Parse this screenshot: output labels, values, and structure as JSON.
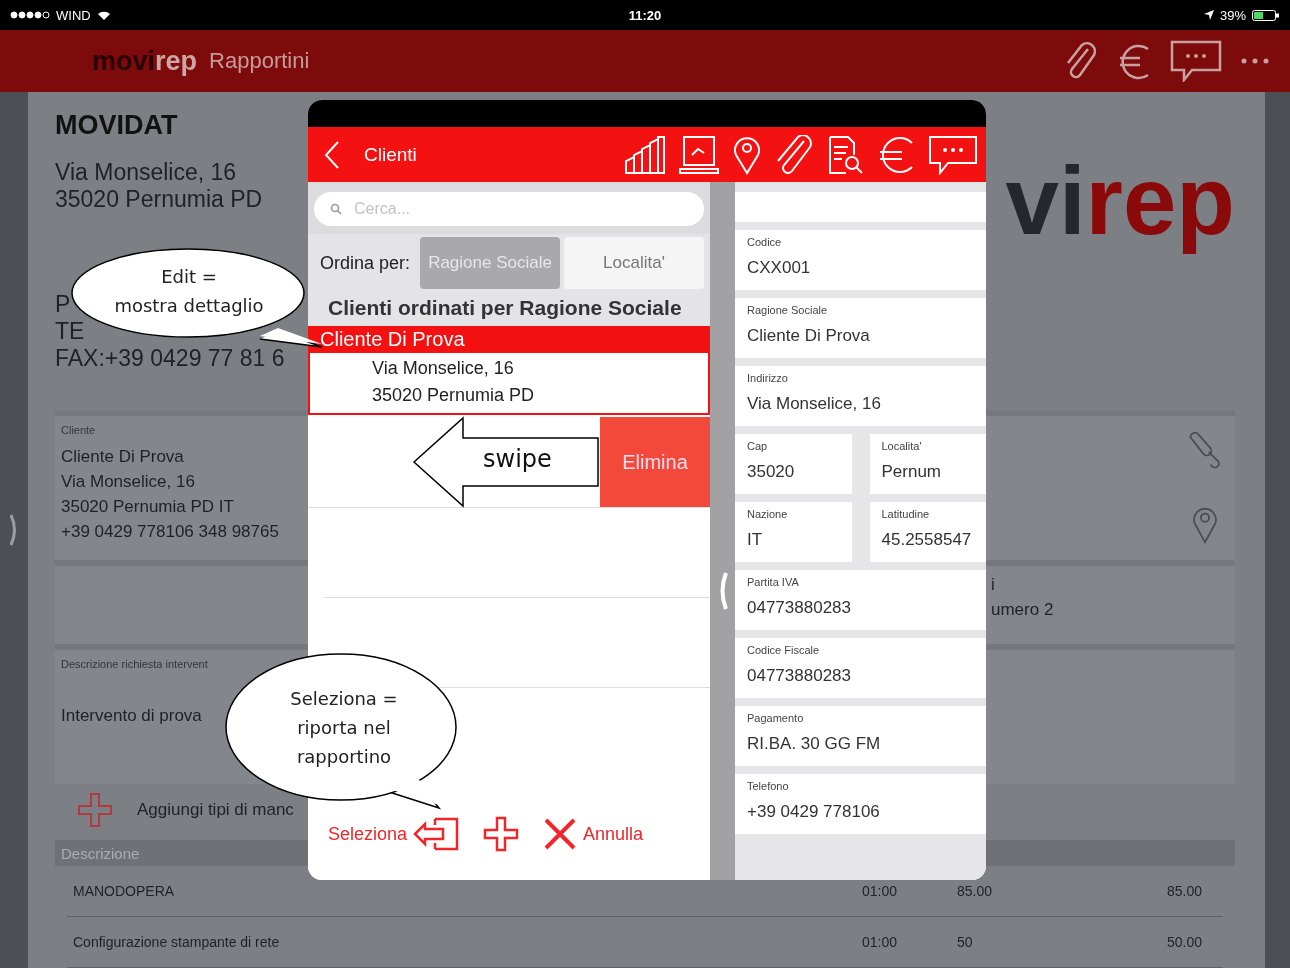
{
  "status_bar": {
    "carrier": "WIND",
    "time": "11:20",
    "battery": "39%"
  },
  "app_header": {
    "logo_dark": "movi",
    "logo_light": "rep",
    "title": "Rapportini"
  },
  "company": {
    "name": "MOVIDAT",
    "address_lines": [
      "Via Monselice, 16",
      "35020 Pernumia PD"
    ],
    "contact_lines": [
      "P",
      "TE",
      "FAX:+39 0429 77 81 6"
    ]
  },
  "logo": {
    "dark": "vi",
    "red": "rep"
  },
  "client_card": {
    "label": "Cliente",
    "lines": [
      "Cliente Di Prova",
      "Via Monselice, 16",
      "35020  Pernumia  PD  IT",
      "+39 0429 778106  348 98765"
    ]
  },
  "side_card": {
    "lines": [
      "i",
      "umero 2"
    ]
  },
  "description": {
    "label": "Descrizione richiesta intervent",
    "text": "Intervento di prova"
  },
  "add_row": {
    "label": "Aggiungi tipi di manc"
  },
  "table": {
    "columns": [
      "Descrizione"
    ],
    "rows": [
      {
        "cells": [
          "MANODOPERA",
          "01:00",
          "85.00",
          "85.00"
        ]
      },
      {
        "cells": [
          "Configurazione stampante di rete",
          "01:00",
          "50",
          "50.00"
        ]
      }
    ]
  },
  "modal": {
    "back_label": "Clienti",
    "search": {
      "placeholder": "Cerca..."
    },
    "sort": {
      "label": "Ordina per:",
      "options": [
        {
          "label": "Ragione Sociale",
          "selected": true
        },
        {
          "label": "Localita'",
          "selected": false
        }
      ]
    },
    "list_heading": "Clienti ordinati per Ragione Sociale",
    "clients": [
      {
        "name": "Cliente Di Prova",
        "lines": [
          "Via Monselice, 16",
          "35020 Pernumia PD"
        ],
        "selected": true
      }
    ],
    "delete_action": "Elimina",
    "toolbar": {
      "select": "Seleziona",
      "cancel": "Annulla"
    },
    "detail_rows": [
      [
        {
          "label": "Codice",
          "value": "CXX001"
        }
      ],
      [
        {
          "label": "Ragione Sociale",
          "value": "Cliente Di Prova"
        }
      ],
      [
        {
          "label": "Indirizzo",
          "value": "Via Monselice, 16"
        }
      ],
      [
        {
          "label": "Cap",
          "value": "35020"
        },
        {
          "label": "Localita'",
          "value": "Pernum"
        }
      ],
      [
        {
          "label": "Nazione",
          "value": "IT"
        },
        {
          "label": "Latitudine",
          "value": "45.2558547"
        }
      ],
      [
        {
          "label": "Partita IVA",
          "value": "04773880283"
        }
      ],
      [
        {
          "label": "Codice Fiscale",
          "value": "04773880283"
        }
      ],
      [
        {
          "label": "Pagamento",
          "value": "RI.BA. 30 GG FM"
        }
      ],
      [
        {
          "label": "Telefono",
          "value": "+39 0429 778106"
        }
      ]
    ]
  },
  "callouts": [
    {
      "kind": "ellipse",
      "lines": [
        "Edit =",
        "mostra dettaglio"
      ]
    },
    {
      "kind": "arrow",
      "lines": [
        "swipe"
      ]
    },
    {
      "kind": "ellipse",
      "lines": [
        "Seleziona =",
        "riporta nel",
        "rapportino"
      ]
    }
  ]
}
